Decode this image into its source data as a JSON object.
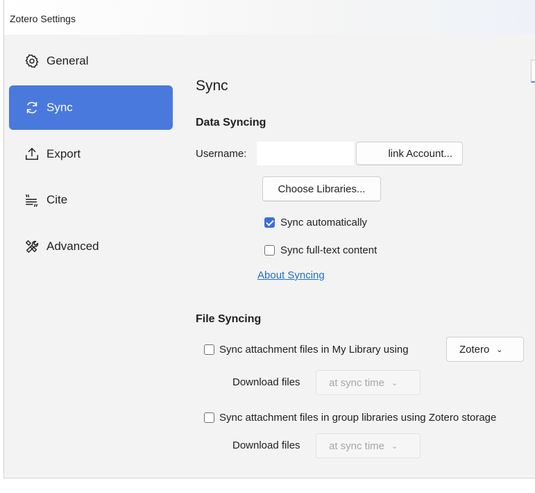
{
  "window": {
    "title": "Zotero Settings"
  },
  "sidebar": {
    "items": [
      {
        "label": "General",
        "icon": "gear-icon",
        "active": false
      },
      {
        "label": "Sync",
        "icon": "sync-icon",
        "active": true
      },
      {
        "label": "Export",
        "icon": "export-icon",
        "active": false
      },
      {
        "label": "Cite",
        "icon": "cite-icon",
        "active": false
      },
      {
        "label": "Advanced",
        "icon": "tools-icon",
        "active": false
      }
    ]
  },
  "pane": {
    "title": "Sync",
    "data_syncing": {
      "heading": "Data Syncing",
      "username_label": "Username:",
      "username_value": "",
      "link_account_label": "link Account...",
      "choose_libraries_label": "Choose Libraries...",
      "sync_auto_label": "Sync automatically",
      "sync_auto_checked": true,
      "sync_fulltext_label": "Sync full-text content",
      "sync_fulltext_checked": false,
      "about_link": "About Syncing"
    },
    "file_syncing": {
      "heading": "File Syncing",
      "my_library_label": "Sync attachment files in My Library using",
      "my_library_checked": false,
      "storage_select": "Zotero",
      "download_label_1": "Download files",
      "download_select_1": "at sync time",
      "group_label": "Sync attachment files in group libraries using Zotero storage",
      "group_checked": false,
      "download_label_2": "Download files",
      "download_select_2": "at sync time"
    }
  },
  "colors": {
    "accent": "#4a79dd",
    "link": "#1d6fc8",
    "checkbox": "#3b6fd8"
  }
}
